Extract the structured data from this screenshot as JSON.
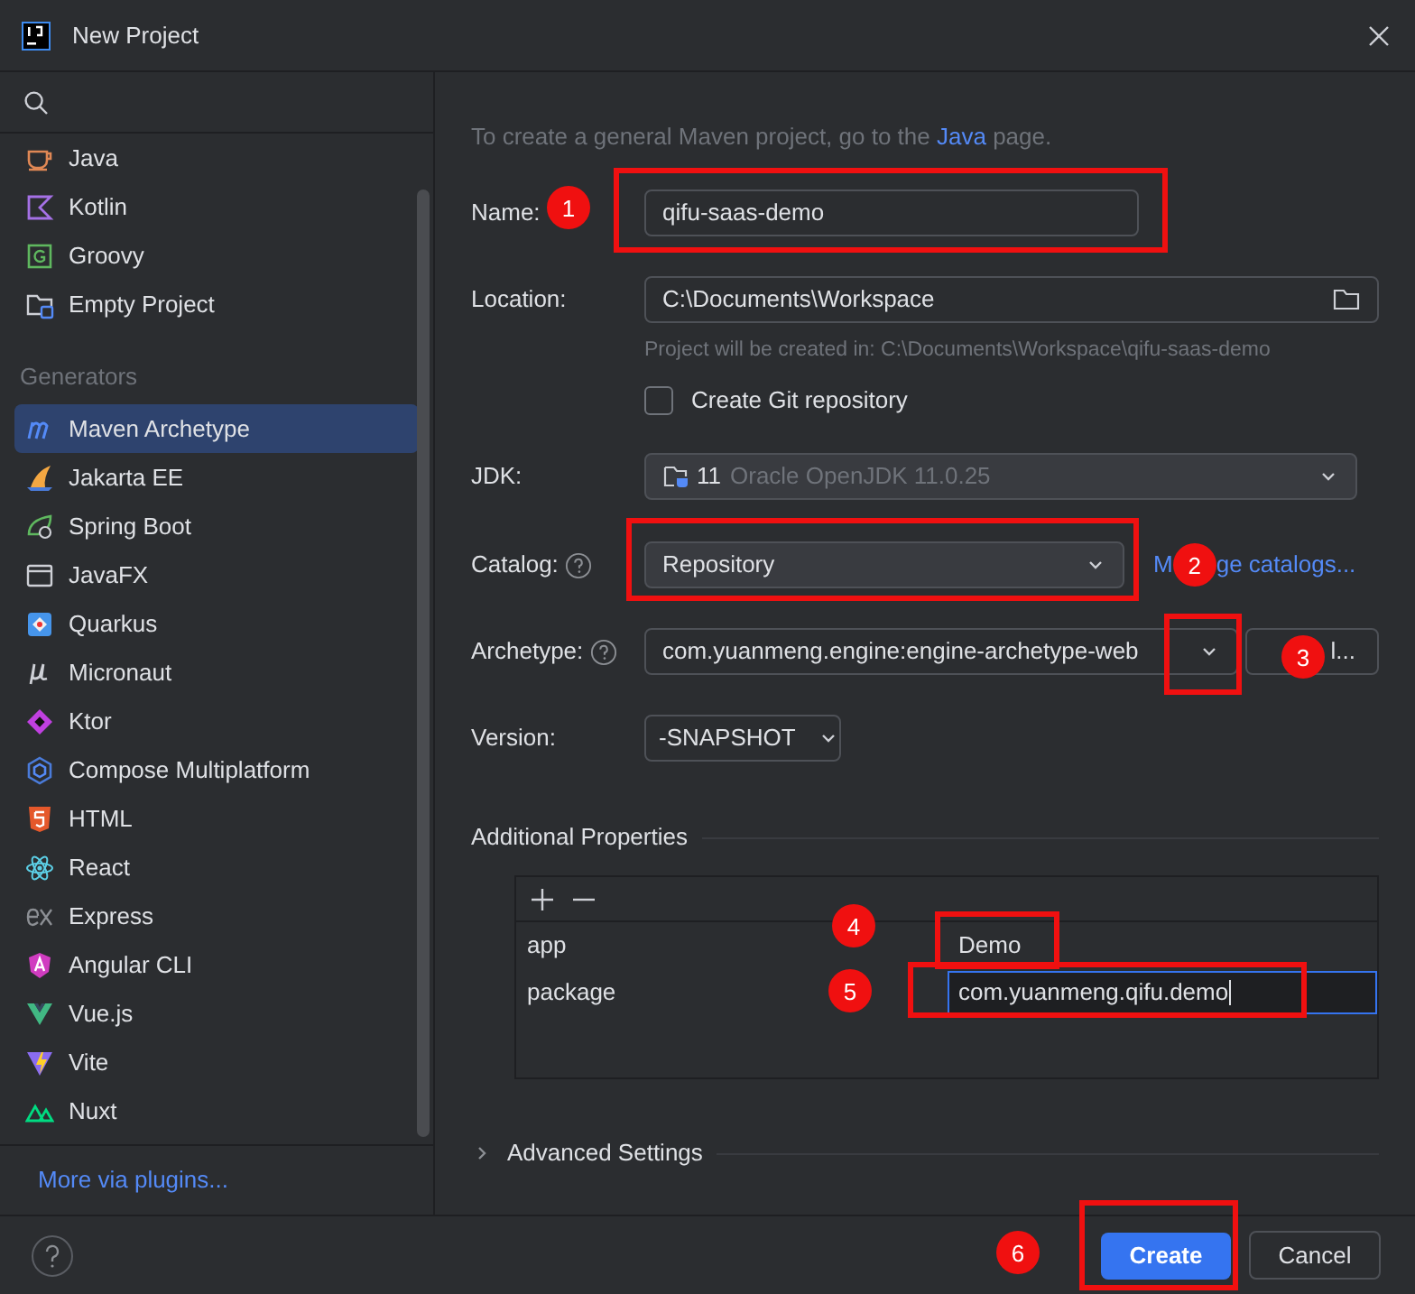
{
  "window": {
    "title": "New Project"
  },
  "sidebar": {
    "project_types": [
      {
        "label": "Java",
        "selected": false
      },
      {
        "label": "Kotlin",
        "selected": false
      },
      {
        "label": "Groovy",
        "selected": false
      },
      {
        "label": "Empty Project",
        "selected": false
      }
    ],
    "generators": {
      "title": "Generators",
      "items": [
        {
          "label": "Maven Archetype",
          "selected": true
        },
        {
          "label": "Jakarta EE",
          "selected": false
        },
        {
          "label": "Spring Boot",
          "selected": false
        },
        {
          "label": "JavaFX",
          "selected": false
        },
        {
          "label": "Quarkus",
          "selected": false
        },
        {
          "label": "Micronaut",
          "selected": false
        },
        {
          "label": "Ktor",
          "selected": false
        },
        {
          "label": "Compose Multiplatform",
          "selected": false
        },
        {
          "label": "HTML",
          "selected": false
        },
        {
          "label": "React",
          "selected": false
        },
        {
          "label": "Express",
          "selected": false
        },
        {
          "label": "Angular CLI",
          "selected": false
        },
        {
          "label": "Vue.js",
          "selected": false
        },
        {
          "label": "Vite",
          "selected": false
        },
        {
          "label": "Nuxt",
          "selected": false
        }
      ]
    },
    "more_link": "More via plugins..."
  },
  "form": {
    "hint": {
      "before": "To create a general Maven project, go to the ",
      "link": "Java",
      "after": " page."
    },
    "name": {
      "label": "Name:",
      "value": "qifu-saas-demo"
    },
    "location": {
      "label": "Location:",
      "value": "C:\\Documents\\Workspace",
      "hint": "Project will be created in: C:\\Documents\\Workspace\\qifu-saas-demo"
    },
    "git": {
      "label": "Create Git repository",
      "checked": false
    },
    "jdk": {
      "label": "JDK:",
      "version": "11",
      "value": "Oracle OpenJDK 11.0.25"
    },
    "catalog": {
      "label": "Catalog:",
      "value": "Repository",
      "link_start": "M",
      "link_end": "ge catalogs..."
    },
    "archetype": {
      "label": "Archetype:",
      "value": "com.yuanmeng.engine:engine-archetype-web",
      "button": "l..."
    },
    "version": {
      "label": "Version:",
      "value": "-SNAPSHOT"
    },
    "properties": {
      "title": "Additional Properties",
      "rows": [
        {
          "key": "app",
          "value": "Demo",
          "editing": false
        },
        {
          "key": "package",
          "value": "com.yuanmeng.qifu.demo",
          "editing": true
        }
      ]
    },
    "advanced": {
      "title": "Advanced Settings",
      "expanded": false
    }
  },
  "buttons": {
    "create": "Create",
    "cancel": "Cancel"
  },
  "annotations": [
    "1",
    "2",
    "3",
    "4",
    "5",
    "6"
  ]
}
